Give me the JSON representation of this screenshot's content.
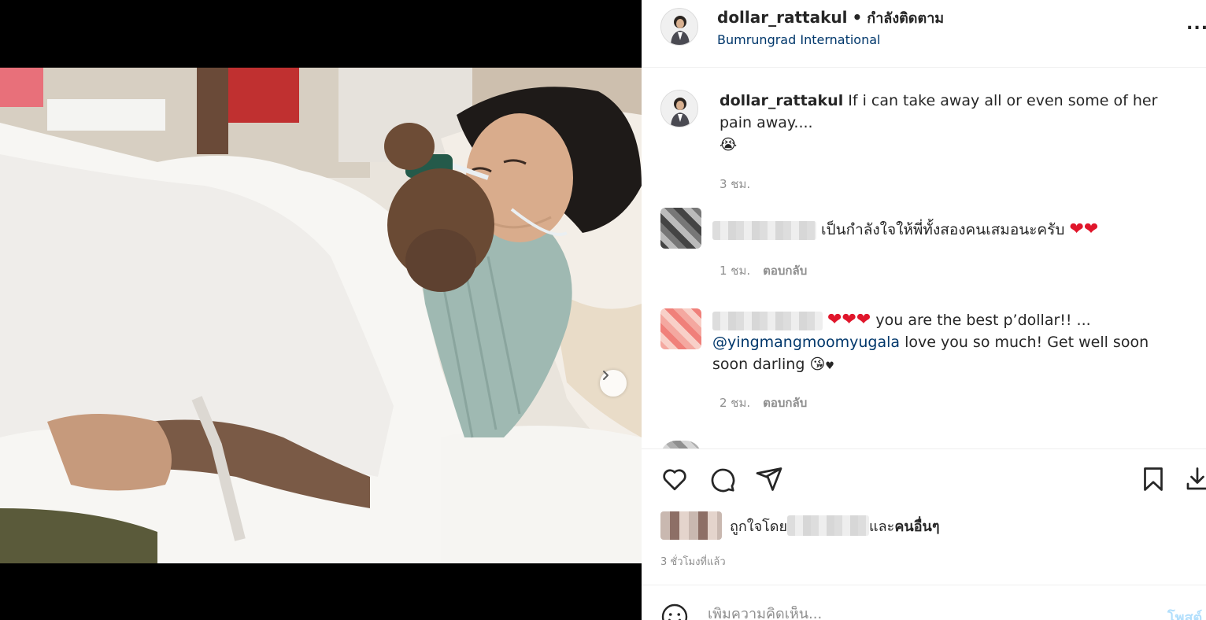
{
  "post": {
    "username": "dollar_rattakul",
    "follow_status": "กำลังติดตาม",
    "location": "Bumrungrad International",
    "caption_text": "If i can take away all or even some of her pain away....",
    "caption_emoji": "😭",
    "caption_time": "3 ชม."
  },
  "comments": [
    {
      "text": "เป็นกำลังใจให้พี่ทั้งสองคนเสมอนะครับ",
      "hearts": "❤❤",
      "time": "1 ชม.",
      "reply": "ตอบกลับ"
    },
    {
      "hearts": "❤❤❤",
      "text_a": "you are the best p’dollar!! ...",
      "mention": "@yingmangmoomyugala",
      "text_b": "love you so much! Get well soon soon darling",
      "emoji": "😘",
      "small_heart": "♥",
      "time": "2 ชม.",
      "reply": "ตอบกลับ"
    }
  ],
  "likes": {
    "prefix": "ถูกใจโดย",
    "connector": "และ",
    "others": "คนอื่นๆ"
  },
  "time_ago": "3 ชั่วโมงที่แล้ว",
  "add_comment": {
    "placeholder": "เพิ่มความคิดเห็น...",
    "post_label": "โพสต์"
  },
  "more_label": "...",
  "colors": {
    "text": "#262626",
    "muted": "#8e8e8e",
    "link": "#00376b",
    "heart": "#e0162b",
    "post_disabled": "#b2dffc"
  },
  "icons": [
    "heart-icon",
    "comment-icon",
    "share-icon",
    "bookmark-icon",
    "download-icon",
    "smile-icon",
    "chevron-right-icon",
    "more-icon"
  ]
}
